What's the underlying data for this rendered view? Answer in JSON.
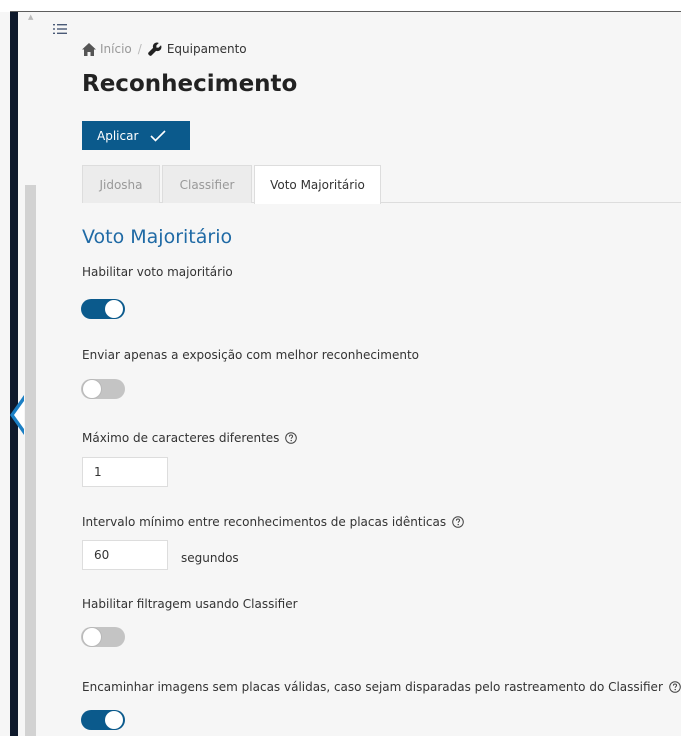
{
  "breadcrumb": {
    "home": "Início",
    "separator": "/",
    "current": "Equipamento"
  },
  "page": {
    "title": "Reconhecimento"
  },
  "toolbar": {
    "apply_label": "Aplicar"
  },
  "tabs": [
    {
      "label": "Jidosha",
      "active": false
    },
    {
      "label": "Classifier",
      "active": false
    },
    {
      "label": "Voto Majoritário",
      "active": true
    }
  ],
  "section": {
    "title": "Voto Majoritário",
    "fields": {
      "enable_majority": {
        "label": "Habilitar voto majoritário",
        "enabled": true
      },
      "best_exposure": {
        "label": "Enviar apenas a exposição com melhor reconhecimento",
        "enabled": false
      },
      "max_chars": {
        "label": "Máximo de caracteres diferentes",
        "value": "1"
      },
      "min_interval": {
        "label": "Intervalo mínimo entre reconhecimentos de placas idênticas",
        "value": "60",
        "unit": "segundos"
      },
      "classifier_filter": {
        "label": "Habilitar filtragem usando Classifier",
        "enabled": false
      },
      "forward_images": {
        "label": "Encaminhar imagens sem placas válidas, caso sejam disparadas pelo rastreamento do Classifier",
        "enabled": true
      }
    }
  },
  "colors": {
    "primary": "#0b5a8c",
    "section_title": "#1f6aa5",
    "sidebar": "#0f1a2c"
  },
  "icons": [
    "menu-icon",
    "home-icon",
    "wrench-icon",
    "check-icon",
    "help-icon",
    "collapse-handle-icon"
  ]
}
